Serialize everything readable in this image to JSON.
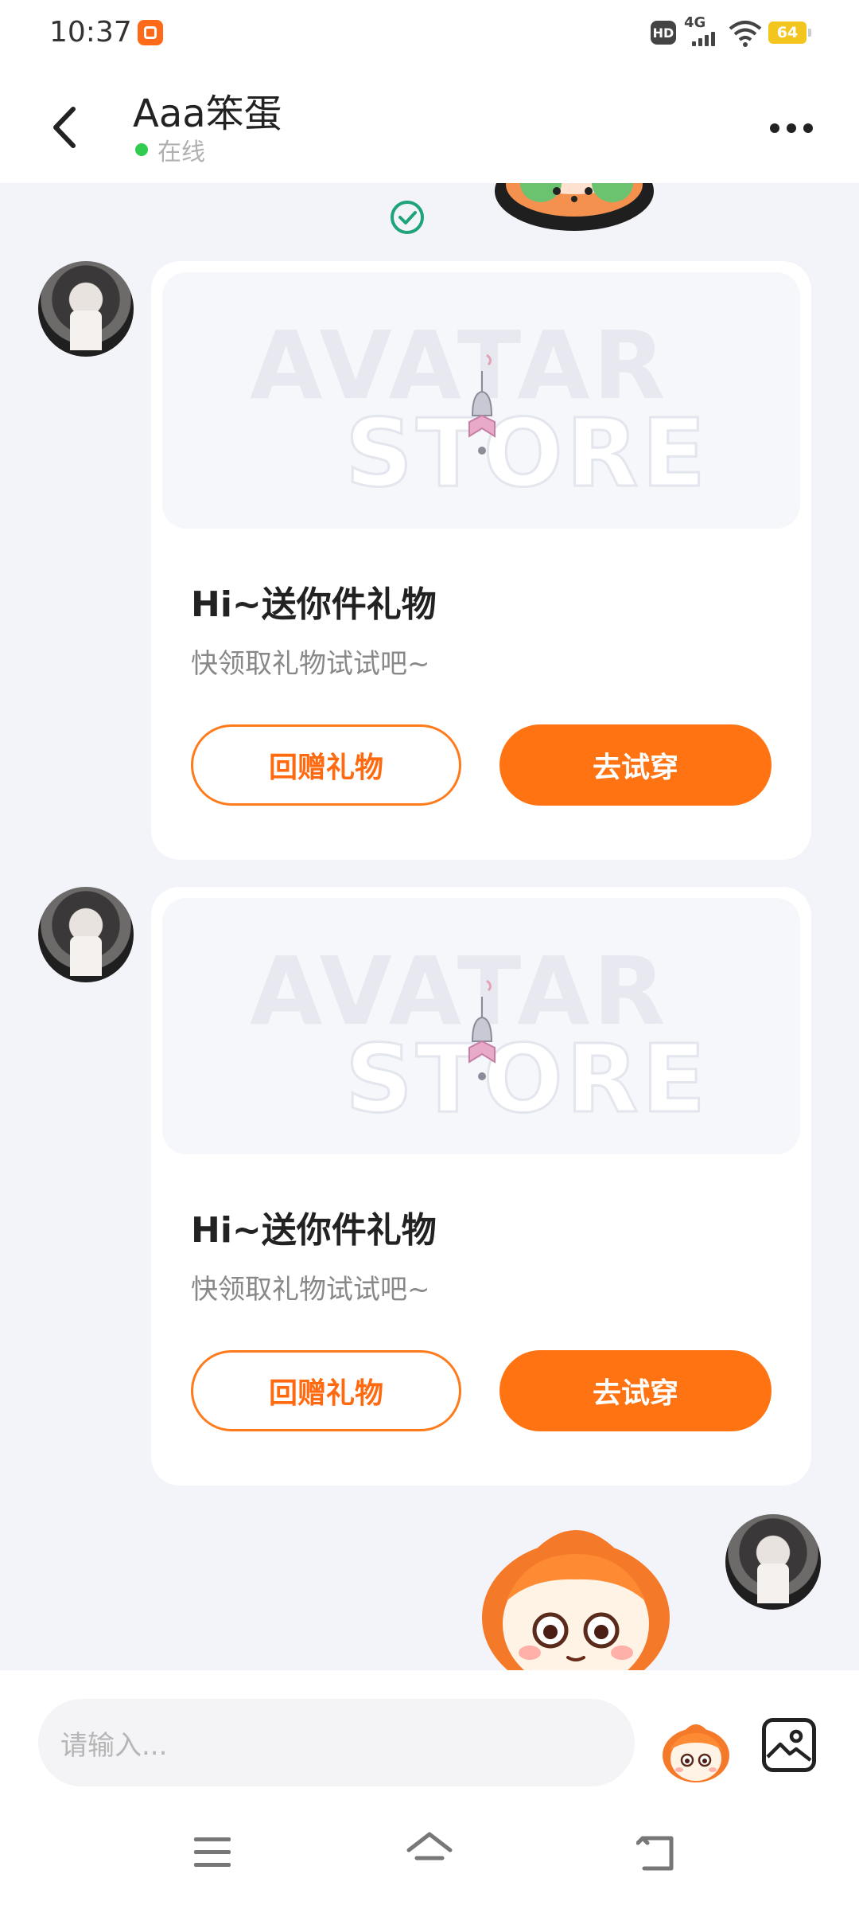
{
  "status_bar": {
    "time": "10:37",
    "hd_label": "HD",
    "network_label": "4G",
    "battery_level": "64"
  },
  "header": {
    "title": "Aaa笨蛋",
    "status": "在线"
  },
  "messages": [
    {
      "card_title": "Hi~送你件礼物",
      "card_subtitle": "快领取礼物试试吧~",
      "secondary_button": "回赠礼物",
      "primary_button": "去试穿"
    },
    {
      "card_title": "Hi~送你件礼物",
      "card_subtitle": "快领取礼物试试吧~",
      "secondary_button": "回赠礼物",
      "primary_button": "去试穿"
    }
  ],
  "input": {
    "placeholder": "请输入..."
  },
  "colors": {
    "accent": "#ff7313",
    "online": "#2fcc4f",
    "read_check": "#1fa37a"
  },
  "icons": {
    "back": "back-arrow-icon",
    "more": "more-icon",
    "read": "check-circle-icon",
    "sticker": "sticker-icon",
    "image": "image-icon",
    "nav_menu": "menu-icon",
    "nav_home": "home-icon",
    "nav_back": "back-icon"
  }
}
